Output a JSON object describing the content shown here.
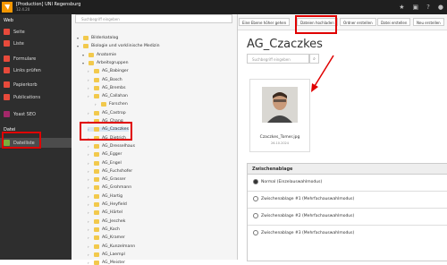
{
  "topbar": {
    "site_title": "[Production] UNI Regensburg",
    "version": "12.4.20",
    "icons": [
      "star-icon",
      "bookmark-icon",
      "help-icon",
      "user-icon"
    ]
  },
  "modules": {
    "groups": [
      {
        "header": "Web",
        "items": [
          "Seite",
          "Liste",
          "Formulare",
          "Links prüfen",
          "Papierkorb",
          "Publications",
          "Yoast SEO"
        ]
      },
      {
        "header": "Datei",
        "items": [
          "Dateiliste"
        ]
      }
    ],
    "active": "Dateiliste"
  },
  "tree": {
    "search_placeholder": "Suchbegriff eingeben",
    "items": [
      {
        "label": "Bilderkatalog",
        "level": 1
      },
      {
        "label": "Biologie und vorklinische Medizin",
        "level": 1
      },
      {
        "label": "Anatomie",
        "level": 2
      },
      {
        "label": "Arbeitsgruppen",
        "level": 2
      },
      {
        "label": "AG_Babinger",
        "level": 3
      },
      {
        "label": "AG_Bosch",
        "level": 3
      },
      {
        "label": "AG_Brembs",
        "level": 3
      },
      {
        "label": "AG_Callahan",
        "level": 3
      },
      {
        "label": "Forschen",
        "level": 4
      },
      {
        "label": "AG_Castrop",
        "level": 3
      },
      {
        "label": "AG_Chang",
        "level": 3
      },
      {
        "label": "AG_Czaczkes",
        "level": 3
      },
      {
        "label": "AG_Dietrich",
        "level": 3
      },
      {
        "label": "AG_Dresselhaus",
        "level": 3
      },
      {
        "label": "AG_Egger",
        "level": 3
      },
      {
        "label": "AG_Engel",
        "level": 3
      },
      {
        "label": "AG_Fuchshofer",
        "level": 3
      },
      {
        "label": "AG_Grasser",
        "level": 3
      },
      {
        "label": "AG_Grohmann",
        "level": 3
      },
      {
        "label": "AG_Hartig",
        "level": 3
      },
      {
        "label": "AG_Heyfield",
        "level": 3
      },
      {
        "label": "AG_Härtel",
        "level": 3
      },
      {
        "label": "AG_Jeschek",
        "level": 3
      },
      {
        "label": "AG_Koch",
        "level": 3
      },
      {
        "label": "AG_Kramer",
        "level": 3
      },
      {
        "label": "AG_Kunzelmann",
        "level": 3
      },
      {
        "label": "AG_Laempl",
        "level": 3
      },
      {
        "label": "AG_Meister",
        "level": 3
      }
    ],
    "selected": "AG_Czaczkes"
  },
  "toolbar": {
    "buttons": [
      "Eine Ebene höher gehen",
      "Dateien hochladen",
      "Ordner erstellen",
      "Datei erstellen",
      "Neu erstellen"
    ]
  },
  "main": {
    "title": "AG_Czaczkes",
    "search_placeholder": "Suchbegriff eingeben",
    "file": {
      "name": "Czaczkes_Tomer.jpg",
      "date": "26.10.2024"
    }
  },
  "clipboard": {
    "header": "Zwischenablage",
    "options": [
      "Normal (Einzelauswahlmodus)",
      "Zwischenablage #1 (Mehrfachauswahlmodus)",
      "Zwischenablage #2 (Mehrfachauswahlmodus)",
      "Zwischenablage #3 (Mehrfachauswahlmodus)"
    ],
    "selected_index": 0
  },
  "colors": {
    "accent_red": "#e00000",
    "typo3_orange": "#f49700"
  }
}
